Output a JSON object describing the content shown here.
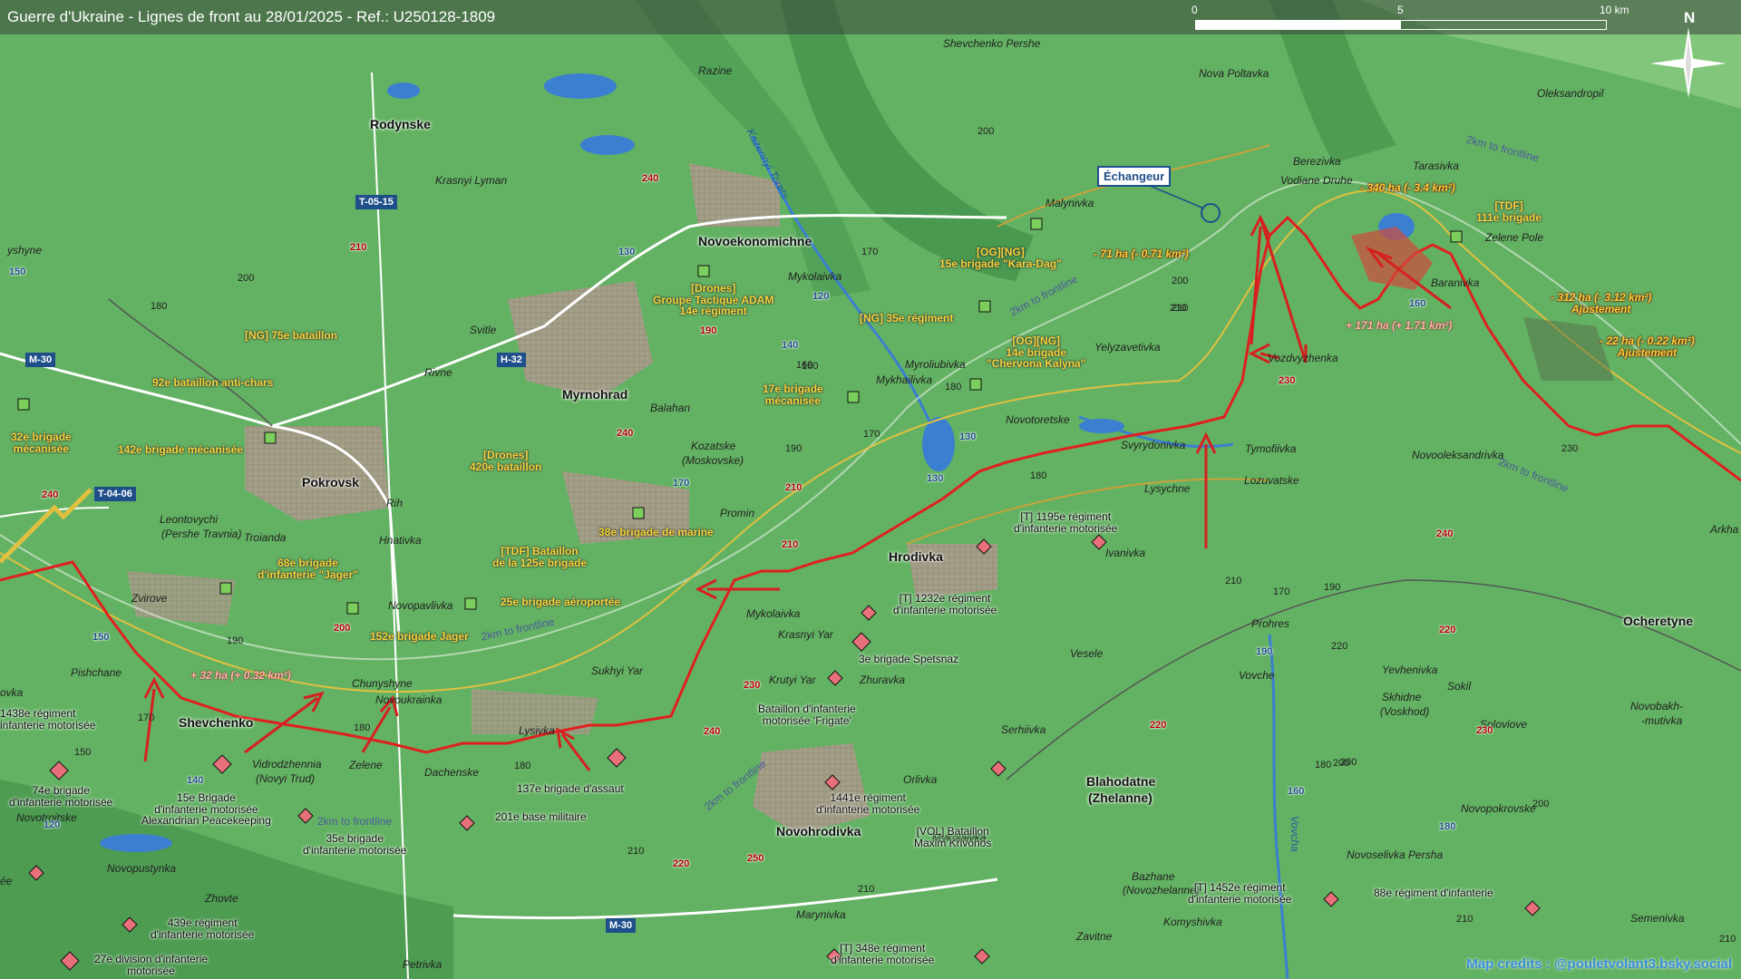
{
  "title": "Guerre d'Ukraine - Lignes de front au 28/01/2025 - Ref.: U250128-1809",
  "scale": {
    "zero": "0",
    "mid": "5",
    "end": "10 km"
  },
  "north_label": "N",
  "credits": "Map credits : @pouletvolant3.bsky.social",
  "callout": "Échangeur",
  "colors": {
    "frontline": "#e02020",
    "arrow": "#d62020",
    "gain_label": "#f5d53a",
    "road_shield": "#1f4f8a",
    "terrain": "#5fae5f"
  },
  "icons": [
    "compass-rose-icon",
    "bridge-crossing-icon",
    "unit-marker-icon",
    "artillery-marker-icon"
  ],
  "cities": {
    "rodynske": "Rodynske",
    "novoekonomichne": "Novoekonomichne",
    "myrnohrad": "Myrnohrad",
    "pokrovsk": "Pokrovsk",
    "hrodivka": "Hrodivka",
    "shevchenko": "Shevchenko",
    "novohrodivka": "Novohrodivka",
    "blahodatne": "Blahodatne",
    "blahodatne2": "(Zhelanne)",
    "ocheretyne": "Ocheretyne"
  },
  "towns": {
    "shevchenko_pershe": "Shevchenko Pershe",
    "nova_poltavka": "Nova Poltavka",
    "oleksandropil": "Oleksandropil",
    "razine": "Razine",
    "krasnyi_lyman": "Krasnyi Lyman",
    "malynivka": "Malynivka",
    "berezivka": "Berezivka",
    "vodiane": "Vodiane Druhe",
    "tarasivka": "Tarasivka",
    "zelene_pole": "Zelene Pole",
    "baranivka": "Baranivka",
    "mykolaivka1": "Mykolaivka",
    "svitle": "Svitle",
    "rivne": "Rivne",
    "yelyzavetivka": "Yelyzavetivka",
    "vozdvyzhenka": "Vozdvyzhenka",
    "myroliubivka": "Myroliubivka",
    "mykhailivka": "Mykhailivka",
    "novotoretske": "Novotoretske",
    "balahan": "Balahan",
    "kozatske": "Kozatske",
    "kozatske2": "(Moskovske)",
    "svyrydonivka": "Svyrydonivka",
    "tymofiivka": "Tymofiivka",
    "novooleksandrivka": "Novooleksandrivka",
    "lozuvatske": "Lozuvatske",
    "lysychne": "Lysychne",
    "rih": "Rih",
    "leontovychi": "Leontovychi",
    "leontovychi2": "(Pershe Travnia)",
    "troianda": "Troianda",
    "hnativka": "Hnativka",
    "promin": "Promin",
    "ivanivka": "Ivanivka",
    "arkha": "Arkha",
    "zvirove": "Zvirove",
    "novopavlivka": "Novopavlivka",
    "mykolaivka2": "Mykolaivka",
    "krasnyi_yar": "Krasnyi Yar",
    "pishchane": "Pishchane",
    "chunyshyne": "Chunyshyne",
    "novoukrainka": "Novoukrainka",
    "sukhyi_yar": "Sukhyi Yar",
    "krutyi_yar": "Krutyi Yar",
    "zhuravka": "Zhuravka",
    "vesele": "Vesele",
    "prohres": "Prohres",
    "vovche": "Vovche",
    "yevhenivka": "Yevhenivka",
    "sokil": "Sokil",
    "skhidne": "Skhidne",
    "skhidne2": "(Voskhod)",
    "soloviove": "Soloviove",
    "novobakh": "Novobakh-",
    "novobakh2": "-mutivka",
    "zelene": "Zelene",
    "dachenske": "Dachenske",
    "lysivka": "Lysivka",
    "vidrodzhennia": "Vidrodzhennia",
    "vidrodzhennia2": "(Novyi Trud)",
    "serhiivka": "Serhiivka",
    "orlivka": "Orlivka",
    "mykolaivka3": "Mykolaivka",
    "novopokrovske": "Novopokrovske",
    "novoselivka": "Novoselivka Persha",
    "novotroitske": "Novotroitske",
    "novopustynka": "Novopustynka",
    "zhovte": "Zhovte",
    "marynivka": "Marynivka",
    "bazhane": "Bazhane",
    "bazhane2": "(Novozhelanne)",
    "komyshivka": "Komyshivka",
    "zavitne": "Zavitne",
    "semenivka": "Semenivka",
    "petrivka": "Petrivka",
    "lyshe": "yshyne",
    "kovka": "ovka",
    "ee": "ée"
  },
  "roads": {
    "t0515": "T-05-15",
    "m30a": "M-30",
    "h32": "H-32",
    "t0406": "T-04-06",
    "m30b": "M-30"
  },
  "units_yellow": {
    "u1a": "[Drones]",
    "u1b": "Groupe Tactique ADAM",
    "u1c": "14e régiment",
    "u2a": "[NG] 75e bataillon",
    "u3": "92e bataillon anti-chars",
    "u4": "142e brigade mécanisée",
    "u5a": "32e brigade",
    "u5b": "mécanisée",
    "u6a": "[Drones]",
    "u6b": "420e bataillon",
    "u7": "38e brigade de marine",
    "u8a": "[TDF] Bataillon",
    "u8b": "de la 125e brigade",
    "u9a": "68e brigade",
    "u9b": "d'infanterie \"Jager\"",
    "u10": "25e brigade aéroportée",
    "u11": "152e brigade Jager",
    "u12": "[NG] 35e régiment",
    "u13a": "17e brigade",
    "u13b": "mécanisée",
    "u14a": "[OG][NG]",
    "u14b": "15e brigade \"Kara-Dag\"",
    "u15a": "[OG][NG]",
    "u15b": "14e brigade",
    "u15c": "\"Chervona Kalyna\"",
    "u16a": "[TDF]",
    "u16b": "111e brigade"
  },
  "units_black": {
    "r1a": "[T] 1195e régiment",
    "r1b": "d'infanterie motorisée",
    "r2": "[T] 1232e régiment d'infanterie motorisée",
    "r3": "3e brigade Spetsnaz",
    "r4a": "Bataillon d'infanterie",
    "r4b": "motorisée 'Frigate'",
    "r5": "137e brigade d'assaut",
    "r6": "201e base militaire",
    "r7a": "1441e régiment",
    "r7b": "d'infanterie motorisée",
    "r8a": "[VOL] Bataillon",
    "r8b": "Maxim Krivonos",
    "r9a": "15e Brigade",
    "r9b": "d'infanterie motorisée",
    "r9c": "Alexandrian Peacekeeping",
    "r10a": "35e brigade",
    "r10b": "d'infanterie motorisée",
    "r11a": "74e brigade",
    "r11b": "d'infanterie motorisée",
    "r12a": "1438e régiment",
    "r12b": "infanterie motorisée",
    "r13a": "439e régiment",
    "r13b": "d'infanterie motorisée",
    "r14a": "27e division d'infanterie",
    "r14b": "motorisée",
    "r15a": "[T] 348e régiment",
    "r15b": "d'infanterie motorisée",
    "r16a": "[T] 1452e régiment",
    "r16b": "d'infanterie motorisée",
    "r17": "88e régiment d'infanterie"
  },
  "gains": {
    "g1": "- 340 ha (- 3.4 km²)",
    "g2": "- 71 ha (- 0.71 km²)",
    "g3": "+ 171 ha (+ 1.71 km²)",
    "g4a": "- 312 ha (- 3.12 km²)",
    "g4b": "Ajustement",
    "g5a": "- 22 ha (- 0.22 km²)",
    "g5b": "Ajustement",
    "g6": "+ 32 ha (+ 0.32 km²)"
  },
  "frontline_labels": {
    "f1": "2km to frontline",
    "f2": "2km to frontline",
    "f3": "2km to frontline",
    "f4": "2km to frontline",
    "f5": "2km to frontline",
    "f6": "2km to frontline"
  },
  "river": "Kazennyi Torets",
  "river2": "Vovcha",
  "route_numbers": {
    "a": "240",
    "b": "210",
    "c": "130",
    "d": "120",
    "e": "140",
    "f": "190",
    "g": "150",
    "h": "130",
    "i": "130",
    "j": "170",
    "k": "240",
    "l": "210",
    "m": "210",
    "n": "230",
    "o": "240",
    "p": "230",
    "q": "220",
    "r": "250",
    "s": "160",
    "t": "180",
    "u": "190",
    "v": "240",
    "w": "230",
    "x": "220",
    "y": "150",
    "z": "140",
    "aa": "120",
    "bb": "160",
    "cc": "180",
    "dd": "220",
    "ee": "150",
    "ff": "200"
  },
  "heights": {
    "a": "200",
    "b": "180",
    "c": "200",
    "d": "170",
    "e": "160",
    "f": "180",
    "g": "190",
    "h": "210",
    "i": "200",
    "j": "180",
    "k": "170",
    "l": "190",
    "m": "230",
    "n": "210",
    "o": "180",
    "p": "170",
    "q": "210",
    "r": "200",
    "s": "220",
    "t": "190",
    "u": "200",
    "v": "210",
    "w": "150",
    "x": "180",
    "y": "180",
    "z": "170",
    "aa": "160",
    "bb": "210",
    "cc": "220",
    "dd": "210",
    "ee": "200",
    "ff": "210"
  }
}
